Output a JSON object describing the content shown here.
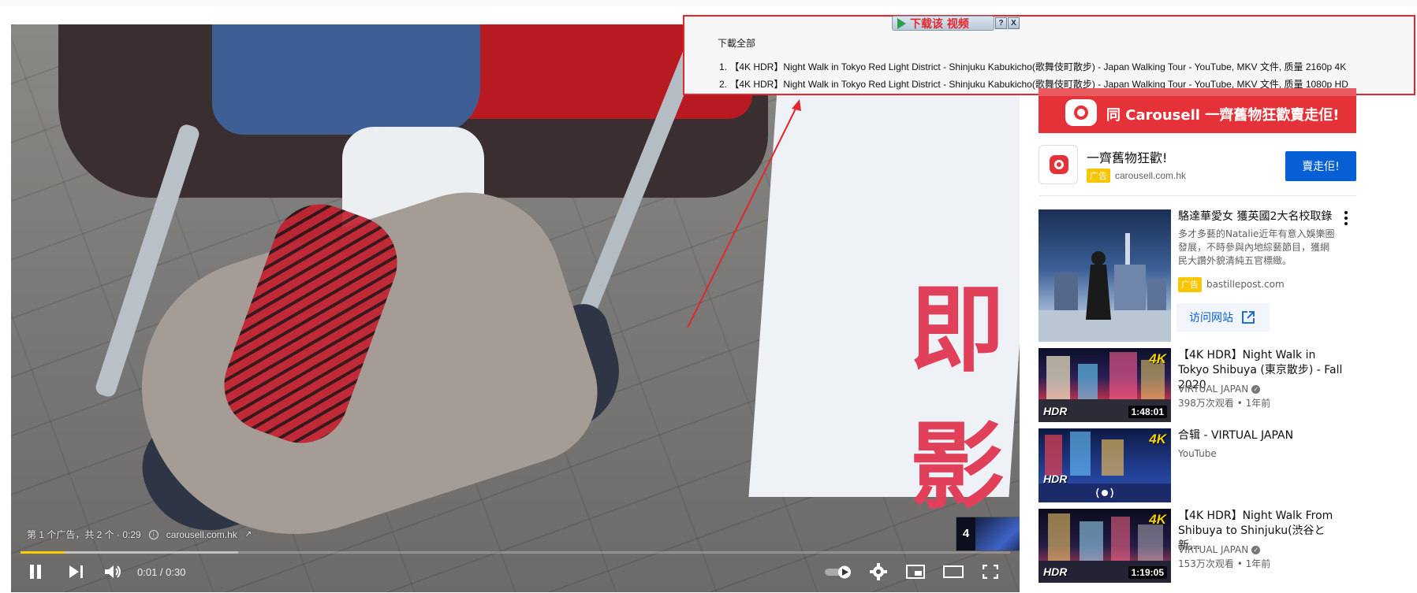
{
  "player": {
    "poster_text": "即影",
    "ad_counter": "第 1 个广告，共 2 个 · 0:29",
    "ad_domain": "carousell.com.hk",
    "time_current": "0:01",
    "time_sep": " / ",
    "time_total": "0:30",
    "progress_fraction": 0.045,
    "buffer_fraction": 0.22,
    "endcard_count": "4"
  },
  "downloader": {
    "tab_label": "下载该 视频",
    "help_label": "?",
    "close_label": "X",
    "download_all": "下載全部",
    "items": [
      "1.   【4K HDR】Night Walk in Tokyo Red Light District - Shinjuku Kabukicho(歌舞伎町散步) - Japan Walking Tour - YouTube,  MKV 文件, 质量 2160p 4K",
      "2.   【4K HDR】Night Walk in Tokyo Red Light District - Shinjuku Kabukicho(歌舞伎町散步) - Japan Walking Tour - YouTube,  MKV 文件, 质量 1080p HD"
    ]
  },
  "sidebar": {
    "banner_text": "同 Carousell 一齊舊物狂歡賣走佢!",
    "ad": {
      "title": "一齊舊物狂歡!",
      "badge": "广告",
      "domain": "carousell.com.hk",
      "cta": "賣走佢!"
    },
    "promo": {
      "title": "駱達華愛女 獲英國2大名校取錄",
      "description": "多才多藝的Natalie近年有意入娛樂圈發展，不時參與內地綜藝節目，獲網民大讚外貌清純五官標緻。",
      "badge": "广告",
      "domain": "bastillepost.com",
      "visit_label": "访问网站"
    },
    "videos": [
      {
        "title": "【4K HDR】Night Walk in Tokyo Shibuya (東京散步) - Fall 2020",
        "channel": "VIRTUAL JAPAN",
        "stats": "398万次观看 • 1年前",
        "duration": "1:48:01",
        "badge_4k": "4K",
        "badge_hdr": "HDR"
      },
      {
        "title": "合辑 - VIRTUAL JAPAN",
        "channel": "YouTube",
        "badge_4k": "4K",
        "badge_hdr": "HDR"
      },
      {
        "title": "【4K HDR】Night Walk From Shibuya to Shinjuku(渋谷と新…",
        "channel": "VIRTUAL JAPAN",
        "stats": "153万次观看 • 1年前",
        "duration": "1:19:05",
        "badge_4k": "4K",
        "badge_hdr": "HDR"
      }
    ]
  },
  "colors": {
    "accent_red": "#e2272d",
    "progress_yellow": "#ffcc00",
    "cta_blue": "#065fd4",
    "ad_badge": "#f9c400",
    "carousell_red": "#e53238"
  }
}
